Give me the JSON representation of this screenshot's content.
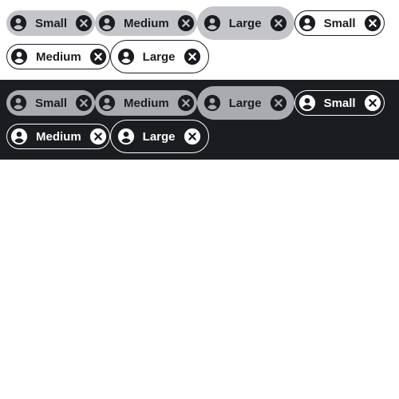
{
  "sections": [
    {
      "theme": "light",
      "chips": [
        {
          "label": "Small",
          "variant": "filled",
          "size": "small",
          "leading_icon": "person-icon",
          "trailing_icon": "close-circle-icon"
        },
        {
          "label": "Medium",
          "variant": "filled",
          "size": "medium",
          "leading_icon": "person-icon",
          "trailing_icon": "close-circle-icon"
        },
        {
          "label": "Large",
          "variant": "filled",
          "size": "large",
          "leading_icon": "person-icon",
          "trailing_icon": "close-circle-icon"
        },
        {
          "label": "Small",
          "variant": "outlined",
          "size": "small",
          "leading_icon": "person-icon",
          "trailing_icon": "close-circle-icon"
        },
        {
          "label": "Medium",
          "variant": "outlined",
          "size": "medium",
          "leading_icon": "person-icon",
          "trailing_icon": "close-circle-icon"
        },
        {
          "label": "Large",
          "variant": "outlined",
          "size": "large",
          "leading_icon": "person-icon",
          "trailing_icon": "close-circle-icon"
        }
      ]
    },
    {
      "theme": "dark",
      "chips": [
        {
          "label": "Small",
          "variant": "filled",
          "size": "small",
          "leading_icon": "person-icon",
          "trailing_icon": "close-circle-icon"
        },
        {
          "label": "Medium",
          "variant": "filled",
          "size": "medium",
          "leading_icon": "person-icon",
          "trailing_icon": "close-circle-icon"
        },
        {
          "label": "Large",
          "variant": "filled",
          "size": "large",
          "leading_icon": "person-icon",
          "trailing_icon": "close-circle-icon"
        },
        {
          "label": "Small",
          "variant": "outlined",
          "size": "small",
          "leading_icon": "person-icon",
          "trailing_icon": "close-circle-icon"
        },
        {
          "label": "Medium",
          "variant": "outlined",
          "size": "medium",
          "leading_icon": "person-icon",
          "trailing_icon": "close-circle-icon"
        },
        {
          "label": "Large",
          "variant": "outlined",
          "size": "large",
          "leading_icon": "person-icon",
          "trailing_icon": "close-circle-icon"
        }
      ]
    }
  ],
  "colors": {
    "light_bg": "#ffffff",
    "dark_bg": "#1b1c20",
    "chip_filled_light": "#c4c5c9",
    "chip_filled_dark": "#a9abb1",
    "text_dark": "#1b1c20",
    "text_light": "#ffffff"
  }
}
